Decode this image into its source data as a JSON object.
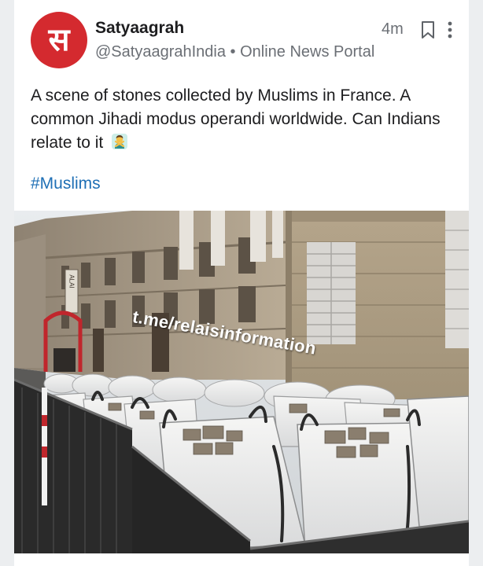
{
  "post": {
    "author_name": "Satyaagrah",
    "handle": "@SatyaagrahIndia",
    "separator": "•",
    "account_type": "Online News Portal",
    "time_ago": "4m",
    "avatar_glyph": "स",
    "text": "A scene of stones collected by Muslims in France. A common Jihadi modus operandi worldwide. Can Indians relate to it",
    "emoji": "person-gesturing-no-icon",
    "hashtag": "#Muslims"
  },
  "image": {
    "watermark": "t.me/relaisinformation",
    "sign_text": "ALAI"
  },
  "colors": {
    "avatar_bg": "#d42a2f",
    "link": "#1e6fb5",
    "text": "#1d1d1f",
    "muted": "#6b6f75"
  }
}
